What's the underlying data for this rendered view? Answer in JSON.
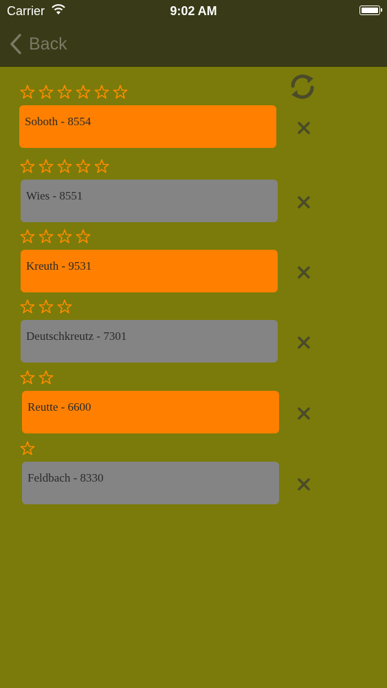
{
  "status_bar": {
    "carrier": "Carrier",
    "time": "9:02 AM"
  },
  "nav": {
    "back_label": "Back"
  },
  "colors": {
    "background": "#7a7b0a",
    "bar": "#393a17",
    "orange": "#ff8000",
    "gray": "#848484",
    "star": "#ff8c00",
    "delete": "#4a4a2a"
  },
  "icons": {
    "back": "chevron-left-icon",
    "refresh": "refresh-arrows-icon",
    "rating": "star-outline-icon",
    "delete": "close-icon"
  },
  "items": [
    {
      "label": "Soboth - 8554",
      "stars": 6,
      "color": "orange"
    },
    {
      "label": "Wies - 8551",
      "stars": 5,
      "color": "gray"
    },
    {
      "label": "Kreuth - 9531",
      "stars": 4,
      "color": "orange"
    },
    {
      "label": "Deutschkreutz - 7301",
      "stars": 3,
      "color": "gray"
    },
    {
      "label": "Reutte - 6600",
      "stars": 2,
      "color": "orange"
    },
    {
      "label": "Feldbach - 8330",
      "stars": 1,
      "color": "gray"
    }
  ]
}
